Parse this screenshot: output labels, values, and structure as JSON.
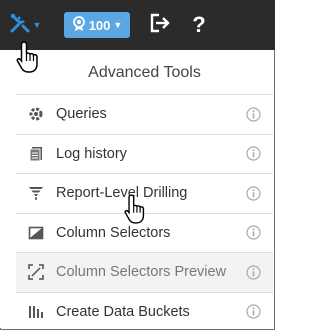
{
  "toolbar": {
    "tools_icon": "tools-icon",
    "badge": {
      "value": "100",
      "icon": "award-icon"
    },
    "logout_icon": "logout-icon",
    "help_label": "?"
  },
  "menu": {
    "title": "Advanced Tools",
    "items": [
      {
        "label": "Queries",
        "icon": "gear-icon",
        "disabled": false
      },
      {
        "label": "Log history",
        "icon": "log-icon",
        "disabled": false
      },
      {
        "label": "Report-Level Drilling",
        "icon": "funnel-icon",
        "disabled": false
      },
      {
        "label": "Column Selectors",
        "icon": "column-selector-icon",
        "disabled": false
      },
      {
        "label": "Column Selectors Preview",
        "icon": "preview-icon",
        "disabled": true
      },
      {
        "label": "Create Data Buckets",
        "icon": "data-buckets-icon",
        "disabled": false
      }
    ]
  },
  "colors": {
    "topbar": "#2b2b2b",
    "accent": "#2f8fd8",
    "badge": "#5aa7e3"
  }
}
